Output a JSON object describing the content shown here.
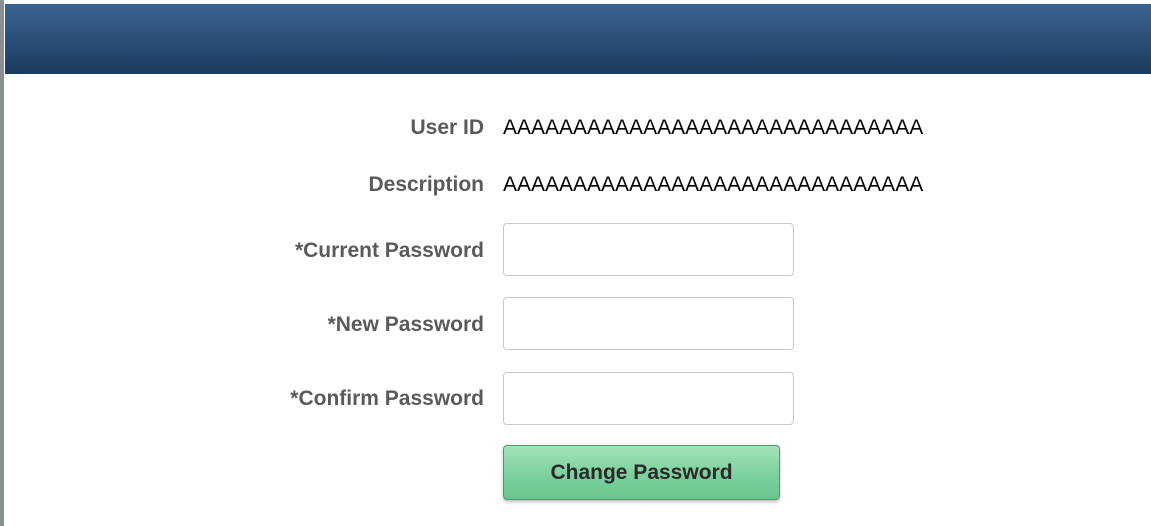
{
  "form": {
    "user_id_label": "User ID",
    "user_id_value": "AAAAAAAAAAAAAAAAAAAAAAAAAAAAAA",
    "description_label": "Description",
    "description_value": "AAAAAAAAAAAAAAAAAAAAAAAAAAAAAA",
    "current_password_label": "*Current Password",
    "current_password_value": "",
    "new_password_label": "*New Password",
    "new_password_value": "",
    "confirm_password_label": "*Confirm Password",
    "confirm_password_value": "",
    "change_button_label": "Change Password"
  },
  "colors": {
    "header_bar": "#2c527a",
    "label_text": "#5a5a5a",
    "button_green": "#7fd2a0"
  }
}
